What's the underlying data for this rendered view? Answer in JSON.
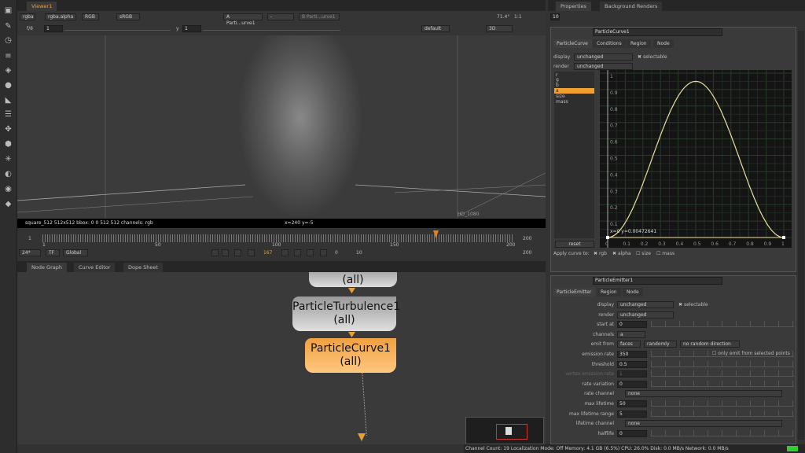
{
  "viewer": {
    "tab": "Viewer1",
    "channels": "rgba",
    "alpha": "rgba.alpha",
    "display": "RGB",
    "colorspace": "sRGB",
    "input_a": "A Parti...urve1",
    "input_a_sel": "-",
    "input_b": "B Parti...urve1",
    "zoom": "71.4°",
    "ratio": "1:1",
    "frame_label": "f/8",
    "frame_val": "1",
    "y_label": "y",
    "y_val": "1",
    "lut": "default",
    "view_mode": "3D",
    "info": "square_512 512x512  bbox: 0 0 512 512 channels: rgb",
    "coords": "x=240 y=-5",
    "format": "HD_1080"
  },
  "timeline": {
    "start": "1",
    "ticks": [
      "1",
      "50",
      "100",
      "150",
      "200"
    ],
    "end": "200",
    "fps": "24*",
    "tf": "TF",
    "scope": "Global",
    "current_frame": "167",
    "skip": "10",
    "in_frame": "0",
    "out_frame": "200",
    "current_fraction": 0.83
  },
  "bottom_tabs": [
    "Node Graph",
    "Curve Editor",
    "Dope Sheet"
  ],
  "nodes": {
    "top_label": "(all)",
    "turbulence": "ParticleTurbulence1",
    "turbulence_sub": "(all)",
    "curve": "ParticleCurve1",
    "curve_sub": "(all)",
    "accent": "#f0b35a"
  },
  "properties": {
    "tabs": [
      "Properties",
      "Background Renders"
    ],
    "max_panels": "10",
    "curve_panel": {
      "name": "ParticleCurve1",
      "tabs": [
        "ParticleCurve",
        "Conditions",
        "Region",
        "Node"
      ],
      "display_label": "display",
      "display": "unchanged",
      "selectable": "selectable",
      "render_label": "render",
      "render": "unchanged",
      "channels": [
        "r",
        "g",
        "b",
        "a",
        "size",
        "mass"
      ],
      "selected_channel": "a",
      "reset": "reset",
      "readout": "x=0 y=0.00472641",
      "x_ticks": [
        "0",
        "0.1",
        "0.2",
        "0.3",
        "0.4",
        "0.5",
        "0.6",
        "0.7",
        "0.8",
        "0.9",
        "1"
      ],
      "y_ticks": [
        "1",
        "0.9",
        "0.8",
        "0.7",
        "0.6",
        "0.5",
        "0.4",
        "0.3",
        "0.2",
        "0.1"
      ],
      "apply_label": "Apply curve to:",
      "apply": [
        {
          "label": "rgb",
          "checked": true
        },
        {
          "label": "alpha",
          "checked": true
        },
        {
          "label": "size",
          "checked": false
        },
        {
          "label": "mass",
          "checked": false
        }
      ],
      "curve_peak": 0.95,
      "curve_color": "#e8e0a0"
    },
    "emitter_panel": {
      "name": "ParticleEmitter1",
      "tabs": [
        "ParticleEmitter",
        "Region",
        "Node"
      ],
      "rows": [
        {
          "label": "display",
          "value": "unchanged",
          "extra": "selectable",
          "type": "dd"
        },
        {
          "label": "render",
          "value": "unchanged",
          "type": "dd"
        },
        {
          "label": "start at",
          "value": "0",
          "type": "slider"
        },
        {
          "label": "channels",
          "value": "a",
          "type": "dd"
        },
        {
          "label": "emit from",
          "value": "faces",
          "v2": "randomly",
          "v3": "no random direction",
          "type": "multi"
        },
        {
          "label": "emission rate",
          "value": "350",
          "extra": "only emit from selected points",
          "type": "slider"
        },
        {
          "label": "threshold",
          "value": "0.5",
          "type": "slider"
        },
        {
          "label": "vertex emission rate",
          "value": "1",
          "type": "slider",
          "disabled": true
        },
        {
          "label": "rate variation",
          "value": "0",
          "type": "slider"
        },
        {
          "label": "rate channel",
          "value": "none",
          "type": "wide"
        },
        {
          "label": "max lifetime",
          "value": "50",
          "type": "slider"
        },
        {
          "label": "max lifetime range",
          "value": "5",
          "type": "slider"
        },
        {
          "label": "lifetime channel",
          "value": "none",
          "type": "wide"
        },
        {
          "label": "halflife",
          "value": "0",
          "type": "slider"
        }
      ]
    }
  },
  "status": "Channel Count: 19 Localization Mode: Off Memory: 4.1 GB (6.5%) CPU: 26.0% Disk: 0.0 MB/s Network: 0.0 MB/s"
}
